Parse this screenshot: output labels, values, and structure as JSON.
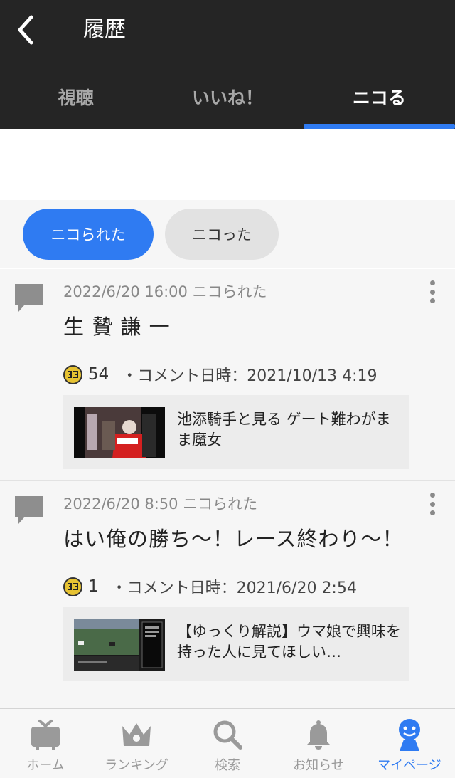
{
  "header": {
    "title": "履歴",
    "tabs": [
      {
        "label": "視聴",
        "active": false
      },
      {
        "label": "いいね！",
        "active": false
      },
      {
        "label": "ニコる",
        "active": true
      }
    ]
  },
  "filters": {
    "active_label": "ニコられた",
    "inactive_label": "ニコった"
  },
  "items": [
    {
      "meta": "2022/6/20 16:00 ニコられた",
      "comment": "生 贄 謙 一",
      "niko_count": "54",
      "comment_date": "・コメント日時：2021/10/13 4:19",
      "video_title": "池添騎手と見る ゲート難わがまま魔女"
    },
    {
      "meta": "2022/6/20 8:50 ニコられた",
      "comment": "はい俺の勝ち〜！レース終わり〜！",
      "niko_count": "1",
      "comment_date": "・コメント日時：2021/6/20 2:54",
      "video_title": "【ゆっくり解説】ウマ娘で興味を持った人に見てほしい…"
    }
  ],
  "bottom_nav": [
    {
      "label": "ホーム",
      "icon": "tv-icon",
      "active": false
    },
    {
      "label": "ランキング",
      "icon": "crown-icon",
      "active": false
    },
    {
      "label": "検索",
      "icon": "search-icon",
      "active": false
    },
    {
      "label": "お知らせ",
      "icon": "bell-icon",
      "active": false
    },
    {
      "label": "マイページ",
      "icon": "mypage-icon",
      "active": true
    }
  ],
  "colors": {
    "accent": "#2f7bf2",
    "header_bg": "#252525"
  }
}
